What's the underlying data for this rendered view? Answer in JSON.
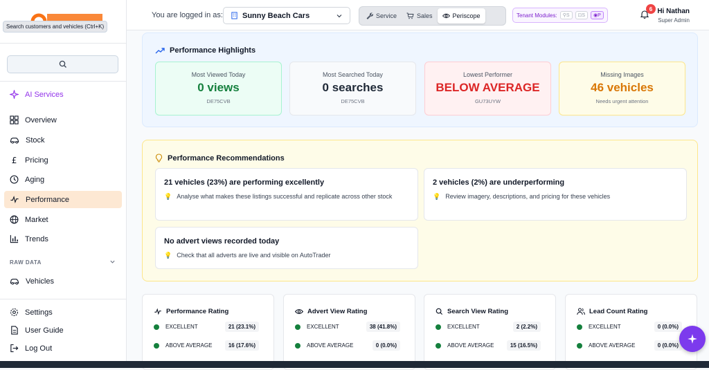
{
  "sidebar": {
    "tooltip": "Search customers and vehicles (Ctrl+K)",
    "ai_services": "AI Services",
    "items": [
      {
        "label": "Overview"
      },
      {
        "label": "Stock"
      },
      {
        "label": "Pricing"
      },
      {
        "label": "Aging"
      },
      {
        "label": "Performance"
      },
      {
        "label": "Market"
      },
      {
        "label": "Trends"
      }
    ],
    "section_raw": "RAW DATA",
    "raw_items": [
      {
        "label": "Vehicles"
      }
    ],
    "bottom": [
      {
        "label": "Settings"
      },
      {
        "label": "User Guide"
      },
      {
        "label": "Log Out"
      }
    ]
  },
  "topbar": {
    "logged_in_label": "You are logged in as:",
    "tenant": "Sunny Beach Cars",
    "modes": [
      "Service",
      "Sales",
      "Periscope"
    ],
    "tenant_modules_label": "Tenant Modules:",
    "modules": [
      "S",
      "S",
      "P"
    ],
    "notification_count": "6",
    "user_name": "Hi Nathan",
    "user_role": "Super Admin"
  },
  "highlights": {
    "title": "Performance Highlights",
    "stats": [
      {
        "label": "Most Viewed Today",
        "value": "0 views",
        "sub": "DE75CVB"
      },
      {
        "label": "Most Searched Today",
        "value": "0 searches",
        "sub": "DE75CVB"
      },
      {
        "label": "Lowest Performer",
        "value": "BELOW AVERAGE",
        "sub": "GU73UYW"
      },
      {
        "label": "Missing Images",
        "value": "46 vehicles",
        "sub": "Needs urgent attention"
      }
    ]
  },
  "recommendations": {
    "title": "Performance Recommendations",
    "items": [
      {
        "heading": "21 vehicles (23%) are performing excellently",
        "detail": "Analyse what makes these listings successful and replicate across other stock"
      },
      {
        "heading": "2 vehicles (2%) are underperforming",
        "detail": "Review imagery, descriptions, and pricing for these vehicles"
      },
      {
        "heading": "No advert views recorded today",
        "detail": "Check that all adverts are live and visible on AutoTrader"
      }
    ]
  },
  "ratings": [
    {
      "title": "Performance Rating",
      "rows": [
        {
          "label": "EXCELLENT",
          "value": "21 (23.1%)"
        },
        {
          "label": "ABOVE AVERAGE",
          "value": "16 (17.6%)"
        }
      ]
    },
    {
      "title": "Advert View Rating",
      "rows": [
        {
          "label": "EXCELLENT",
          "value": "38 (41.8%)"
        },
        {
          "label": "ABOVE AVERAGE",
          "value": "0 (0.0%)"
        }
      ]
    },
    {
      "title": "Search View Rating",
      "rows": [
        {
          "label": "EXCELLENT",
          "value": "2 (2.2%)"
        },
        {
          "label": "ABOVE AVERAGE",
          "value": "15 (16.5%)"
        }
      ]
    },
    {
      "title": "Lead Count Rating",
      "rows": [
        {
          "label": "EXCELLENT",
          "value": "0 (0.0%)"
        },
        {
          "label": "ABOVE AVERAGE",
          "value": "0 (0.0%)"
        }
      ]
    }
  ],
  "colors": {
    "accent": "#f97316",
    "ai": "#9333ea",
    "green": "#15803d",
    "red": "#dc2626",
    "orange": "#d97706"
  }
}
